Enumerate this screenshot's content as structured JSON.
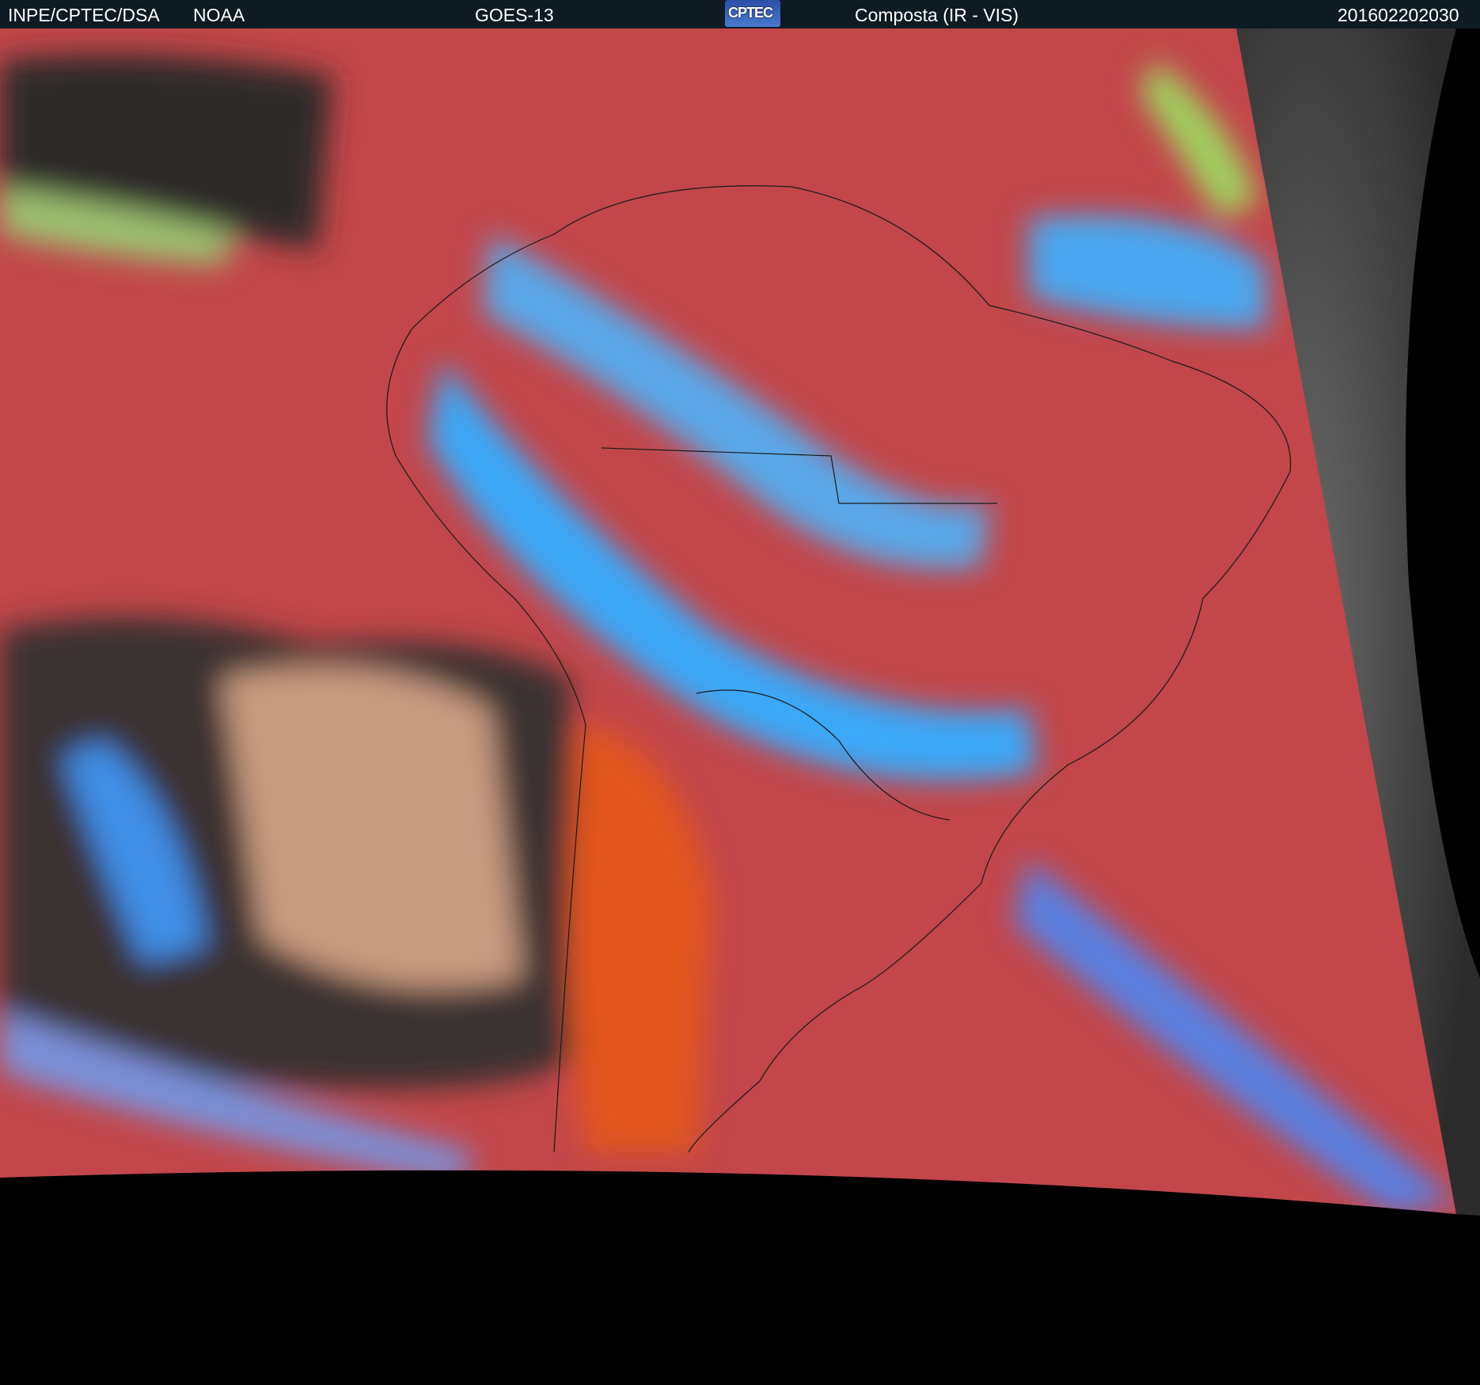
{
  "header": {
    "agency": "INPE/CPTEC/DSA",
    "partner": "NOAA",
    "satellite": "GOES-13",
    "logo_text": "CPTEC",
    "product": "Composta (IR - VIS)",
    "timestamp": "201602202030"
  },
  "colors": {
    "header_bg": "#0f1b23",
    "ocean_clear": "#c2464a",
    "land_clear": "#d8502e",
    "high_cloud": "#33aaff",
    "low_cloud": "#8fcf70",
    "dark_sea": "#2a2a2a"
  }
}
